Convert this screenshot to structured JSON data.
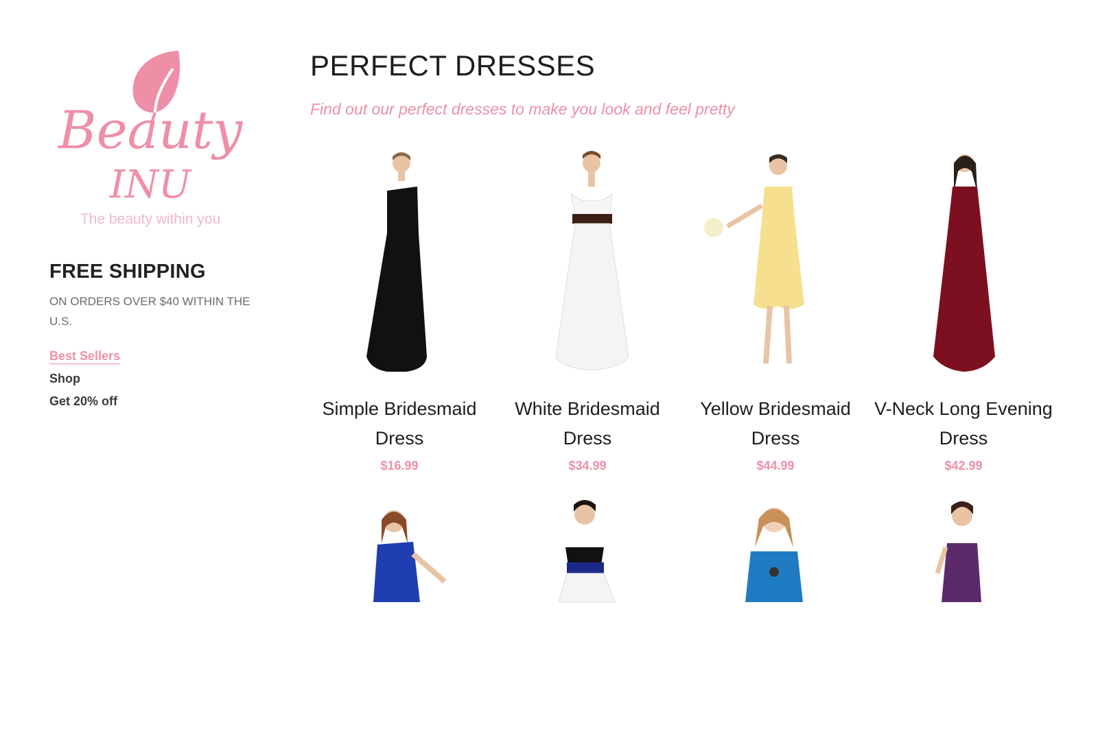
{
  "brand": {
    "name_line1": "Beauty",
    "name_line2": "INU",
    "tagline": "The beauty within you",
    "color": "#ee8fa7"
  },
  "sidebar": {
    "shipping_title": "FREE SHIPPING",
    "shipping_note": "ON ORDERS OVER $40 WITHIN THE U.S.",
    "nav": [
      {
        "label": "Best Sellers",
        "active": true
      },
      {
        "label": "Shop",
        "active": false
      },
      {
        "label": "Get 20% off",
        "active": false
      }
    ]
  },
  "main": {
    "title": "PERFECT DRESSES",
    "subtitle": "Find out our perfect dresses to make you look and feel pretty"
  },
  "products": [
    {
      "name": "Simple Bridesmaid Dress",
      "price": "$16.99",
      "dress_color": "#111111"
    },
    {
      "name": "White Bridesmaid Dress",
      "price": "$34.99",
      "dress_color": "#f4f4f4"
    },
    {
      "name": "Yellow Bridesmaid Dress",
      "price": "$44.99",
      "dress_color": "#f6e08f"
    },
    {
      "name": "V-Neck Long Evening Dress",
      "price": "$42.99",
      "dress_color": "#7d1020"
    },
    {
      "dress_color": "#1f3fb0"
    },
    {
      "dress_color": "#1b2a8a"
    },
    {
      "dress_color": "#1f7cc4"
    },
    {
      "dress_color": "#5c2a6b"
    }
  ]
}
